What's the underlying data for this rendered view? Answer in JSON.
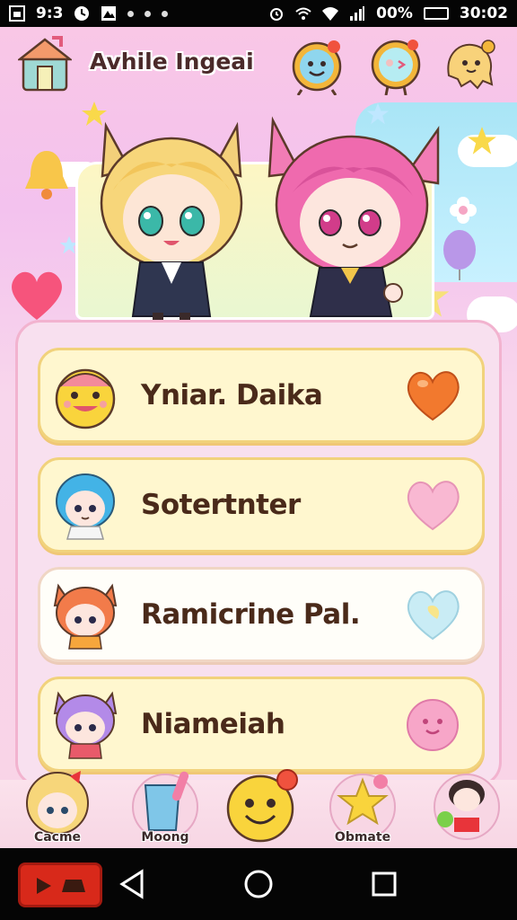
{
  "status_bar": {
    "time_left": "9:3",
    "battery": "00%",
    "clock": "30:02"
  },
  "header": {
    "title": "Avhile Ingeai",
    "icons": [
      "house-icon",
      "clock-face-icon",
      "mirror-wink-icon",
      "ghost-icon"
    ]
  },
  "friends": [
    {
      "name": "Yniar. Daika",
      "avatar": "yellow-smiley-avatar",
      "heart": "orange-heart-icon"
    },
    {
      "name": "Sotertnter",
      "avatar": "blue-hair-girl-avatar",
      "heart": "pink-heart-icon"
    },
    {
      "name": "Ramicrine Pal.",
      "avatar": "orange-cat-girl-avatar",
      "heart": "pastel-heart-icon"
    },
    {
      "name": "Niameiah",
      "avatar": "purple-cat-girl-avatar",
      "heart": "pink-face-icon"
    }
  ],
  "tabs": [
    {
      "label": "Cacme",
      "icon": "blonde-girl-icon"
    },
    {
      "label": "Moong",
      "icon": "drink-cup-icon"
    },
    {
      "label": "",
      "icon": "smiley-icon"
    },
    {
      "label": "Obmate",
      "icon": "star-badge-icon"
    },
    {
      "label": "",
      "icon": "boy-character-icon"
    }
  ],
  "colors": {
    "background": "#f9c7e6",
    "panel": "#f8e0ef",
    "row": "#fff7cf",
    "text": "#4a2a1a"
  }
}
